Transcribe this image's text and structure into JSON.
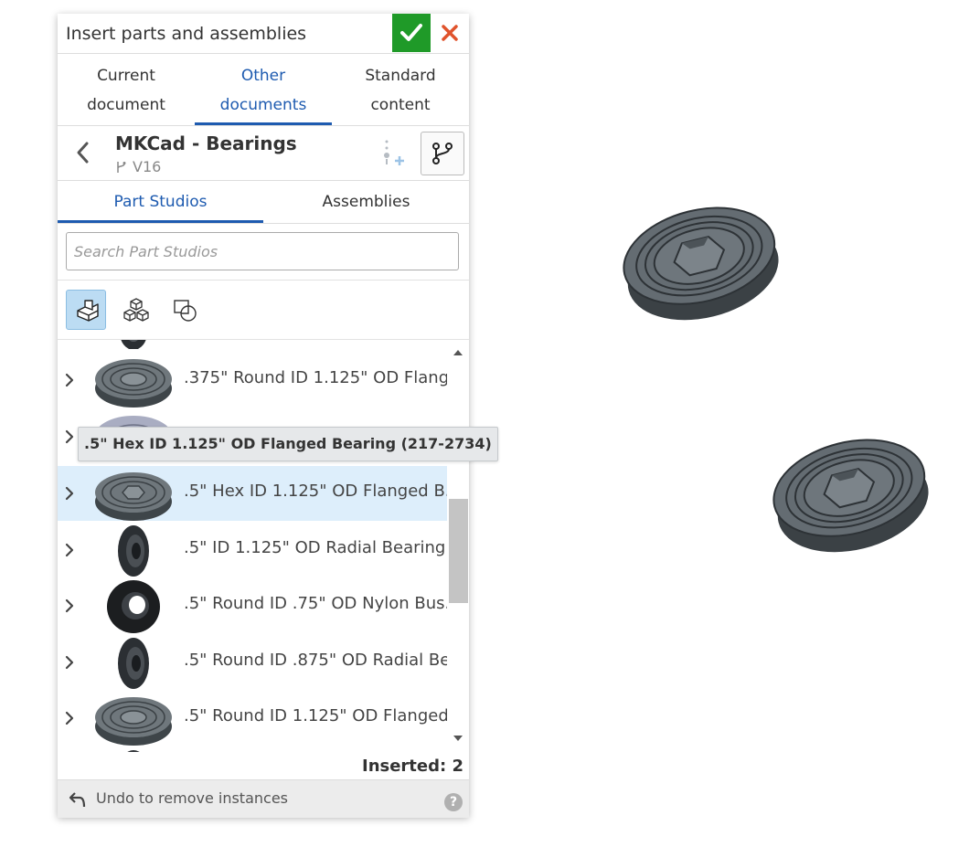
{
  "dialog": {
    "title": "Insert parts and assemblies",
    "confirm_icon": "checkmark-icon",
    "close_icon": "close-x-icon",
    "colors": {
      "confirm": "#1f9a28",
      "close": "#e0532c",
      "accent": "#1e5bb0",
      "selected_row": "#ddeefb"
    }
  },
  "source_tabs": [
    {
      "line1": "Current",
      "line2": "document",
      "active": false
    },
    {
      "line1": "Other",
      "line2": "documents",
      "active": true
    },
    {
      "line1": "Standard",
      "line2": "content",
      "active": false
    }
  ],
  "document": {
    "name": "MKCad - Bearings",
    "version": "V16",
    "back_icon": "chevron-left-icon",
    "insert_config_icon": "insert-configuration-icon",
    "branch_icon": "branch-icon"
  },
  "sub_tabs": [
    {
      "label": "Part Studios",
      "active": true
    },
    {
      "label": "Assemblies",
      "active": false
    }
  ],
  "search": {
    "placeholder": "Search Part Studios",
    "value": ""
  },
  "filters": [
    {
      "icon": "part-icon",
      "active": true
    },
    {
      "icon": "multiple-parts-icon",
      "active": false
    },
    {
      "icon": "sketch-icon",
      "active": false
    }
  ],
  "parts": [
    {
      "label": ".375\" Round ID 1.125\" OD Flang...",
      "thumb": "flanged-bearing",
      "selected": false
    },
    {
      "label": "",
      "thumb": "flanged-bearing-light",
      "selected": false
    },
    {
      "label": ".5\" Hex ID 1.125\" OD Flanged B...",
      "thumb": "flanged-bearing-hex",
      "selected": true
    },
    {
      "label": ".5\" ID 1.125\" OD Radial Bearing ...",
      "thumb": "radial-bearing",
      "selected": false
    },
    {
      "label": ".5\" Round ID .75\" OD Nylon Bus...",
      "thumb": "nylon-bushing",
      "selected": false
    },
    {
      "label": ".5\" Round ID .875\" OD Radial Be...",
      "thumb": "radial-bearing",
      "selected": false
    },
    {
      "label": ".5\" Round ID 1.125\" OD Flanged ...",
      "thumb": "flanged-bearing",
      "selected": false
    }
  ],
  "tooltip": ".5\" Hex ID 1.125\" OD Flanged Bearing (217-2734)",
  "status": {
    "inserted": "Inserted: 2"
  },
  "footer": {
    "undo": "Undo to remove instances",
    "help": "?"
  },
  "viewport": {
    "models": [
      "hex-flanged-bearing-model",
      "hex-flanged-bearing-model"
    ]
  }
}
